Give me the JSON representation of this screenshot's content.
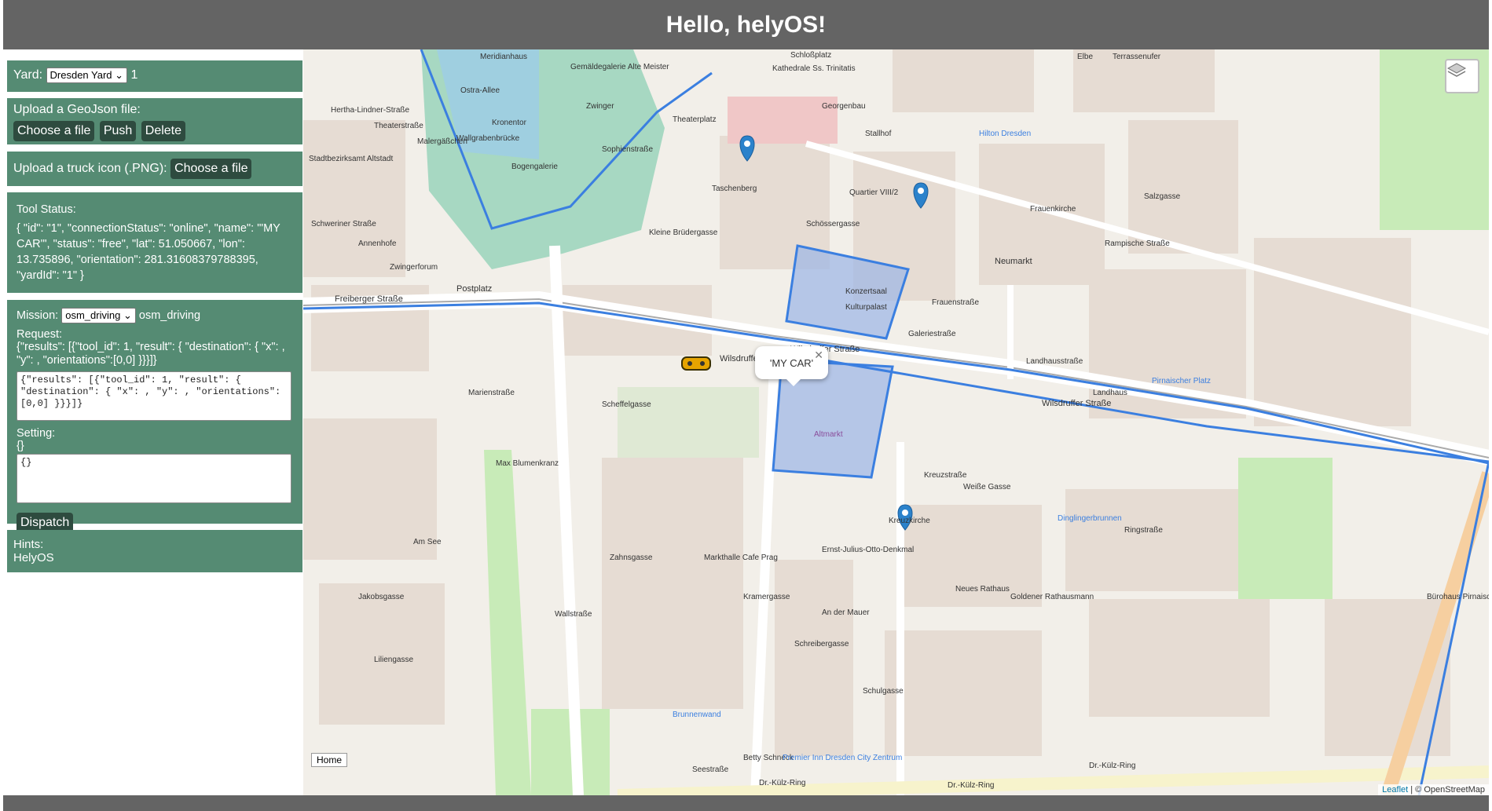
{
  "header": {
    "title": "Hello, helyOS!"
  },
  "yard": {
    "label": "Yard:",
    "selected": "Dresden Yard",
    "value": "1"
  },
  "upload_geojson": {
    "label": "Upload a GeoJson file:",
    "choose_label": "Choose a file",
    "push_label": "Push",
    "delete_label": "Delete"
  },
  "upload_icon": {
    "label": "Upload a truck icon (.PNG):",
    "choose_label": "Choose a file"
  },
  "tool_status": {
    "title": "Tool Status:",
    "text": "{ \"id\": \"1\", \"connectionStatus\": \"online\", \"name\": \"'MY CAR'\", \"status\": \"free\", \"lat\": 51.050667, \"lon\": 13.735896, \"orientation\": 281.31608379788395, \"yardId\": \"1\" }"
  },
  "mission": {
    "label": "Mission:",
    "selected": "osm_driving",
    "value": "osm_driving",
    "request_label": "Request:",
    "request_text": "{\"results\": [{\"tool_id\": 1, \"result\": { \"destination\": { \"x\": , \"y\": , \"orientations\":[0,0] }}}]}",
    "request_input": "{\"results\": [{\"tool_id\": 1, \"result\": { \"destination\": { \"x\": , \"y\": , \"orientations\": [0,0] }}}]}",
    "setting_label": "Setting:",
    "setting_text": "{}",
    "setting_input": "{}",
    "dispatch_label": "Dispatch"
  },
  "hints": {
    "title": "Hints:",
    "text": "HelyOS"
  },
  "map": {
    "popup_text": "'MY CAR'",
    "home_label": "Home",
    "attribution_leaflet": "Leaflet",
    "attribution_osm": "| © OpenStreetMap",
    "route_color": "#3b7fe0",
    "zone_fill_color": "#9bb5e6",
    "labels": {
      "freiberger": "Freiberger Straße",
      "postplatz": "Postplatz",
      "wilsdruffer": "Wilsdruffer Straße",
      "wilsdruffer2": "Wilsdruffer Straße",
      "wilsdruffer3": "Wilsdruffer Straße",
      "altmarkt": "Altmarkt",
      "kulturpalast": "Kulturpalast",
      "konzertsaal": "Konzertsaal",
      "kreuzkirche": "Kreuzkirche",
      "frauenkirche": "Frauenkirche",
      "neumarkt": "Neumarkt",
      "zwingerforum": "Zwingerforum",
      "wallgraben": "Wallgrabenbrücke",
      "bogengalerie": "Bogengalerie",
      "kronentor": "Kronentor",
      "schlossplatz": "Schloßplatz",
      "terrassenufer": "Terrassenufer",
      "taschenberg": "Taschenberg",
      "kleine_bruder": "Kleine Brüdergasse",
      "marienstrasse": "Marienstraße",
      "scheffelgasse": "Scheffelgasse",
      "seestrasse": "Seestraße",
      "kreuzstrasse": "Kreuzstraße",
      "ringstrasse": "Ringstraße",
      "dr_kulz": "Dr.-Külz-Ring",
      "dr_kulz2": "Dr.-Külz-Ring",
      "dr_kulz3": "Dr.-Külz-Ring",
      "galeriestrasse": "Galeriestraße",
      "frauenstrasse": "Frauenstraße",
      "schossergasse": "Schössergasse",
      "annenhofe": "Annenhofe",
      "schweriner": "Schweriner Straße",
      "brunnenwand": "Brunnenwand",
      "zahnsgasse": "Zahnsgasse",
      "wallstrasse": "Wallstraße",
      "am_see": "Am See",
      "jakobsgasse": "Jakobsgasse",
      "liliengasse": "Liliengasse",
      "schulgasse": "Schulgasse",
      "kramergasse": "Kramergasse",
      "schreiberg": "Schreibergasse",
      "weisse_gasse": "Weiße Gasse",
      "salzgasse": "Salzgasse",
      "rampische": "Rampische Straße",
      "landhausstr": "Landhausstraße",
      "landhaus": "Landhaus",
      "pirnaischer": "Pirnaischer Platz",
      "buerohaus": "Bürohaus Pirnaisches Tor",
      "neues_rathaus": "Neues Rathaus",
      "goldener": "Goldener Rathausmann",
      "dingl": "Dinglingerbrunnen",
      "max_blumen": "Max Blumenkranz",
      "markthalle": "Markthalle Cafe Prag",
      "betty": "Betty Schneck",
      "premier": "Premier Inn Dresden City Zentrum",
      "ernst": "Ernst-Julius-Otto-Denkmal",
      "am_der_mauer": "An der Mauer",
      "kathedrale": "Kathedrale Ss. Trinitatis",
      "georgenbau": "Georgenbau",
      "stallhof": "Stallhof",
      "hilton": "Hilton Dresden",
      "quartier": "Quartier VIII/2",
      "altstadt": "Stadtbezirksamt Altstadt",
      "hertha": "Hertha-Lindner-Straße",
      "theaterstr": "Theaterstraße",
      "malergasschen": "Malergäßchen",
      "ostra": "Ostra-Allee",
      "sophien": "Sophienstraße",
      "theaterplatz": "Theaterplatz",
      "zwinger": "Zwinger",
      "meridian": "Meridianhaus",
      "gemalde": "Gemäldegalerie Alte Meister",
      "elbe": "Elbe"
    }
  }
}
